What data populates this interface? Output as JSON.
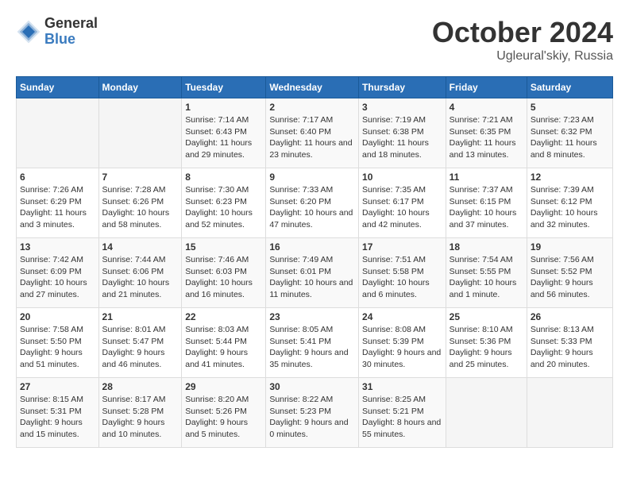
{
  "header": {
    "logo_general": "General",
    "logo_blue": "Blue",
    "month_title": "October 2024",
    "location": "Ugleural'skiy, Russia"
  },
  "days_of_week": [
    "Sunday",
    "Monday",
    "Tuesday",
    "Wednesday",
    "Thursday",
    "Friday",
    "Saturday"
  ],
  "weeks": [
    [
      {
        "day": "",
        "info": ""
      },
      {
        "day": "",
        "info": ""
      },
      {
        "day": "1",
        "sunrise": "Sunrise: 7:14 AM",
        "sunset": "Sunset: 6:43 PM",
        "daylight": "Daylight: 11 hours and 29 minutes."
      },
      {
        "day": "2",
        "sunrise": "Sunrise: 7:17 AM",
        "sunset": "Sunset: 6:40 PM",
        "daylight": "Daylight: 11 hours and 23 minutes."
      },
      {
        "day": "3",
        "sunrise": "Sunrise: 7:19 AM",
        "sunset": "Sunset: 6:38 PM",
        "daylight": "Daylight: 11 hours and 18 minutes."
      },
      {
        "day": "4",
        "sunrise": "Sunrise: 7:21 AM",
        "sunset": "Sunset: 6:35 PM",
        "daylight": "Daylight: 11 hours and 13 minutes."
      },
      {
        "day": "5",
        "sunrise": "Sunrise: 7:23 AM",
        "sunset": "Sunset: 6:32 PM",
        "daylight": "Daylight: 11 hours and 8 minutes."
      }
    ],
    [
      {
        "day": "6",
        "sunrise": "Sunrise: 7:26 AM",
        "sunset": "Sunset: 6:29 PM",
        "daylight": "Daylight: 11 hours and 3 minutes."
      },
      {
        "day": "7",
        "sunrise": "Sunrise: 7:28 AM",
        "sunset": "Sunset: 6:26 PM",
        "daylight": "Daylight: 10 hours and 58 minutes."
      },
      {
        "day": "8",
        "sunrise": "Sunrise: 7:30 AM",
        "sunset": "Sunset: 6:23 PM",
        "daylight": "Daylight: 10 hours and 52 minutes."
      },
      {
        "day": "9",
        "sunrise": "Sunrise: 7:33 AM",
        "sunset": "Sunset: 6:20 PM",
        "daylight": "Daylight: 10 hours and 47 minutes."
      },
      {
        "day": "10",
        "sunrise": "Sunrise: 7:35 AM",
        "sunset": "Sunset: 6:17 PM",
        "daylight": "Daylight: 10 hours and 42 minutes."
      },
      {
        "day": "11",
        "sunrise": "Sunrise: 7:37 AM",
        "sunset": "Sunset: 6:15 PM",
        "daylight": "Daylight: 10 hours and 37 minutes."
      },
      {
        "day": "12",
        "sunrise": "Sunrise: 7:39 AM",
        "sunset": "Sunset: 6:12 PM",
        "daylight": "Daylight: 10 hours and 32 minutes."
      }
    ],
    [
      {
        "day": "13",
        "sunrise": "Sunrise: 7:42 AM",
        "sunset": "Sunset: 6:09 PM",
        "daylight": "Daylight: 10 hours and 27 minutes."
      },
      {
        "day": "14",
        "sunrise": "Sunrise: 7:44 AM",
        "sunset": "Sunset: 6:06 PM",
        "daylight": "Daylight: 10 hours and 21 minutes."
      },
      {
        "day": "15",
        "sunrise": "Sunrise: 7:46 AM",
        "sunset": "Sunset: 6:03 PM",
        "daylight": "Daylight: 10 hours and 16 minutes."
      },
      {
        "day": "16",
        "sunrise": "Sunrise: 7:49 AM",
        "sunset": "Sunset: 6:01 PM",
        "daylight": "Daylight: 10 hours and 11 minutes."
      },
      {
        "day": "17",
        "sunrise": "Sunrise: 7:51 AM",
        "sunset": "Sunset: 5:58 PM",
        "daylight": "Daylight: 10 hours and 6 minutes."
      },
      {
        "day": "18",
        "sunrise": "Sunrise: 7:54 AM",
        "sunset": "Sunset: 5:55 PM",
        "daylight": "Daylight: 10 hours and 1 minute."
      },
      {
        "day": "19",
        "sunrise": "Sunrise: 7:56 AM",
        "sunset": "Sunset: 5:52 PM",
        "daylight": "Daylight: 9 hours and 56 minutes."
      }
    ],
    [
      {
        "day": "20",
        "sunrise": "Sunrise: 7:58 AM",
        "sunset": "Sunset: 5:50 PM",
        "daylight": "Daylight: 9 hours and 51 minutes."
      },
      {
        "day": "21",
        "sunrise": "Sunrise: 8:01 AM",
        "sunset": "Sunset: 5:47 PM",
        "daylight": "Daylight: 9 hours and 46 minutes."
      },
      {
        "day": "22",
        "sunrise": "Sunrise: 8:03 AM",
        "sunset": "Sunset: 5:44 PM",
        "daylight": "Daylight: 9 hours and 41 minutes."
      },
      {
        "day": "23",
        "sunrise": "Sunrise: 8:05 AM",
        "sunset": "Sunset: 5:41 PM",
        "daylight": "Daylight: 9 hours and 35 minutes."
      },
      {
        "day": "24",
        "sunrise": "Sunrise: 8:08 AM",
        "sunset": "Sunset: 5:39 PM",
        "daylight": "Daylight: 9 hours and 30 minutes."
      },
      {
        "day": "25",
        "sunrise": "Sunrise: 8:10 AM",
        "sunset": "Sunset: 5:36 PM",
        "daylight": "Daylight: 9 hours and 25 minutes."
      },
      {
        "day": "26",
        "sunrise": "Sunrise: 8:13 AM",
        "sunset": "Sunset: 5:33 PM",
        "daylight": "Daylight: 9 hours and 20 minutes."
      }
    ],
    [
      {
        "day": "27",
        "sunrise": "Sunrise: 8:15 AM",
        "sunset": "Sunset: 5:31 PM",
        "daylight": "Daylight: 9 hours and 15 minutes."
      },
      {
        "day": "28",
        "sunrise": "Sunrise: 8:17 AM",
        "sunset": "Sunset: 5:28 PM",
        "daylight": "Daylight: 9 hours and 10 minutes."
      },
      {
        "day": "29",
        "sunrise": "Sunrise: 8:20 AM",
        "sunset": "Sunset: 5:26 PM",
        "daylight": "Daylight: 9 hours and 5 minutes."
      },
      {
        "day": "30",
        "sunrise": "Sunrise: 8:22 AM",
        "sunset": "Sunset: 5:23 PM",
        "daylight": "Daylight: 9 hours and 0 minutes."
      },
      {
        "day": "31",
        "sunrise": "Sunrise: 8:25 AM",
        "sunset": "Sunset: 5:21 PM",
        "daylight": "Daylight: 8 hours and 55 minutes."
      },
      {
        "day": "",
        "info": ""
      },
      {
        "day": "",
        "info": ""
      }
    ]
  ]
}
